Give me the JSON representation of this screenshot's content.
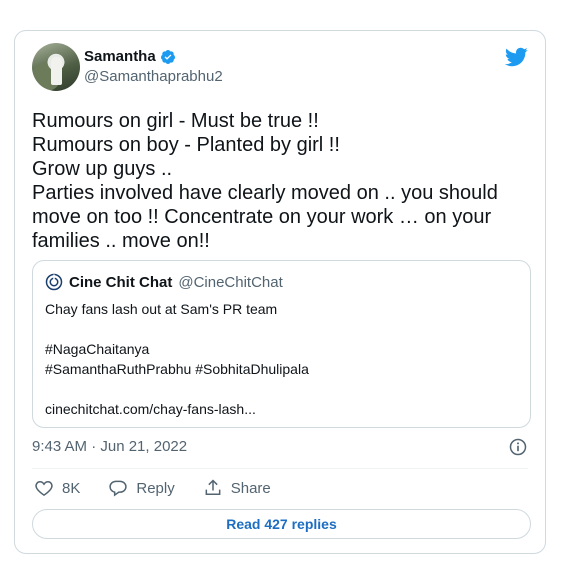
{
  "colors": {
    "accent": "#1d9bf0",
    "text": "#0f1419",
    "muted": "#536471",
    "border": "#cfd9de"
  },
  "author": {
    "name": "Samantha",
    "handle": "@Samanthaprabhu2",
    "verified_icon": "verified-badge-icon"
  },
  "brand_icon": "twitter-bird-icon",
  "tweet": {
    "text": "Rumours on girl - Must be true !!\nRumours on boy - Planted by girl !!\nGrow up guys ..\nParties involved have clearly moved on .. you should move on too !! Concentrate on your work … on your families .. move on!!"
  },
  "quoted": {
    "name": "Cine Chit Chat",
    "handle": "@CineChitChat",
    "text": "Chay fans lash out at Sam's PR team\n\n#NagaChaitanya\n#SamanthaRuthPrabhu #SobhitaDhulipala\n\ncinechitchat.com/chay-fans-lash..."
  },
  "meta": {
    "timestamp": "9:43 AM · Jun 21, 2022"
  },
  "actions": {
    "likes": "8K",
    "reply": "Reply",
    "share": "Share"
  },
  "read_replies": "Read 427 replies"
}
